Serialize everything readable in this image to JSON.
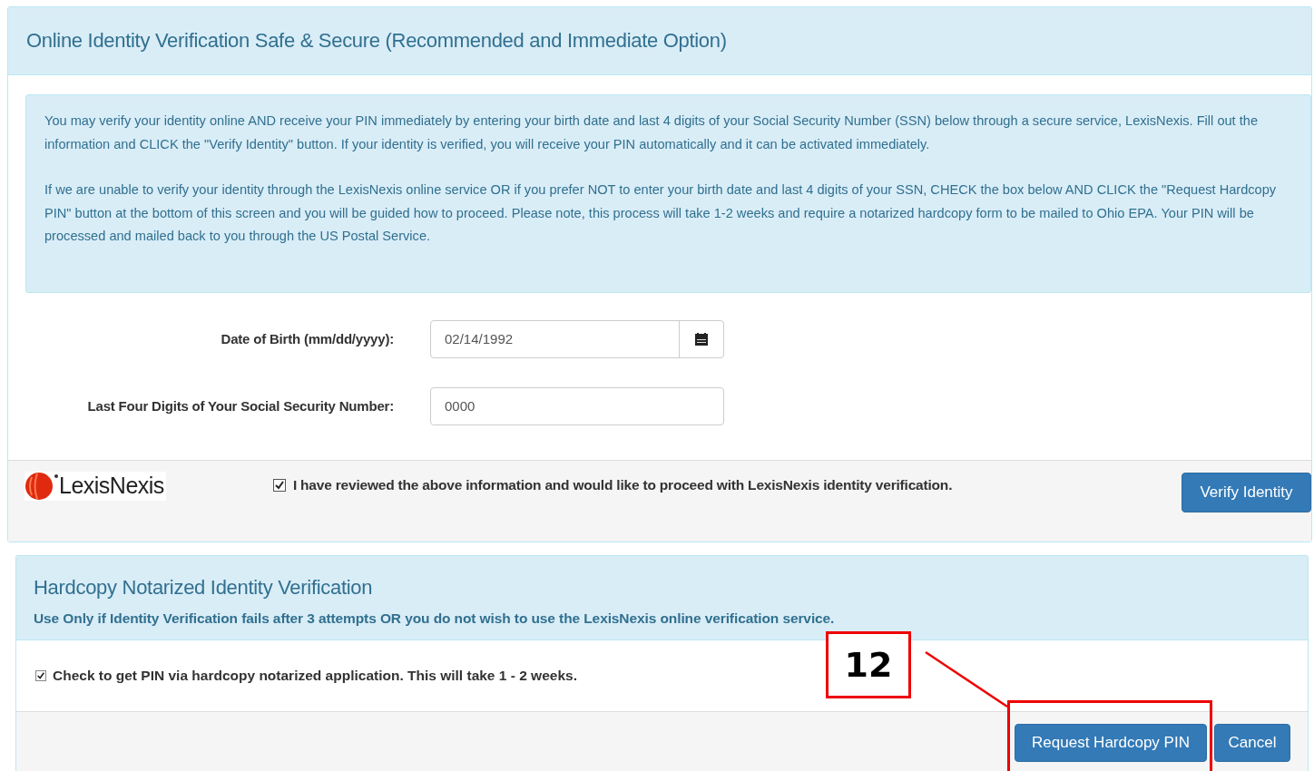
{
  "online_panel": {
    "title": "Online Identity Verification Safe & Secure (Recommended and Immediate Option)",
    "info": [
      "You may verify your identity online AND receive your PIN immediately by entering your birth date and last 4 digits of your Social Security Number (SSN) below through a secure service, LexisNexis. Fill out the information and CLICK the \"Verify Identity\" button. If your identity is verified, you will receive your PIN automatically and it can be activated immediately.",
      "If we are unable to verify your identity through the LexisNexis online service OR if you prefer NOT to enter your birth date and last 4 digits of your SSN, CHECK the box below AND CLICK the \"Request Hardcopy PIN\" button at the bottom of this screen and you will be guided how to proceed. Please note, this process will take 1-2 weeks and require a notarized hardcopy form to be mailed to Ohio EPA. Your PIN will be processed and mailed back to you through the US Postal Service."
    ],
    "fields": [
      {
        "kind": "date",
        "label": "Date of Birth (mm/dd/yyyy):",
        "value": "02/14/1992"
      },
      {
        "kind": "text",
        "label": "Last Four Digits of Your Social Security Number:",
        "value": "0000"
      }
    ],
    "logo_text": "LexisNexis",
    "consent": {
      "label": "I have reviewed the above information and would like to proceed with LexisNexis identity verification.",
      "checked": true
    },
    "button": "Verify Identity"
  },
  "hardcopy_panel": {
    "title": "Hardcopy Notarized Identity Verification",
    "subtitle": "Use Only if Identity Verification fails after 3 attempts OR you do not wish to use the LexisNexis online verification service.",
    "option": {
      "label": "Check to get PIN via hardcopy notarized application. This will take 1 - 2 weeks.",
      "checked": true
    },
    "buttons": [
      "Request Hardcopy PIN",
      "Cancel"
    ]
  },
  "annotation": {
    "label": "12"
  }
}
